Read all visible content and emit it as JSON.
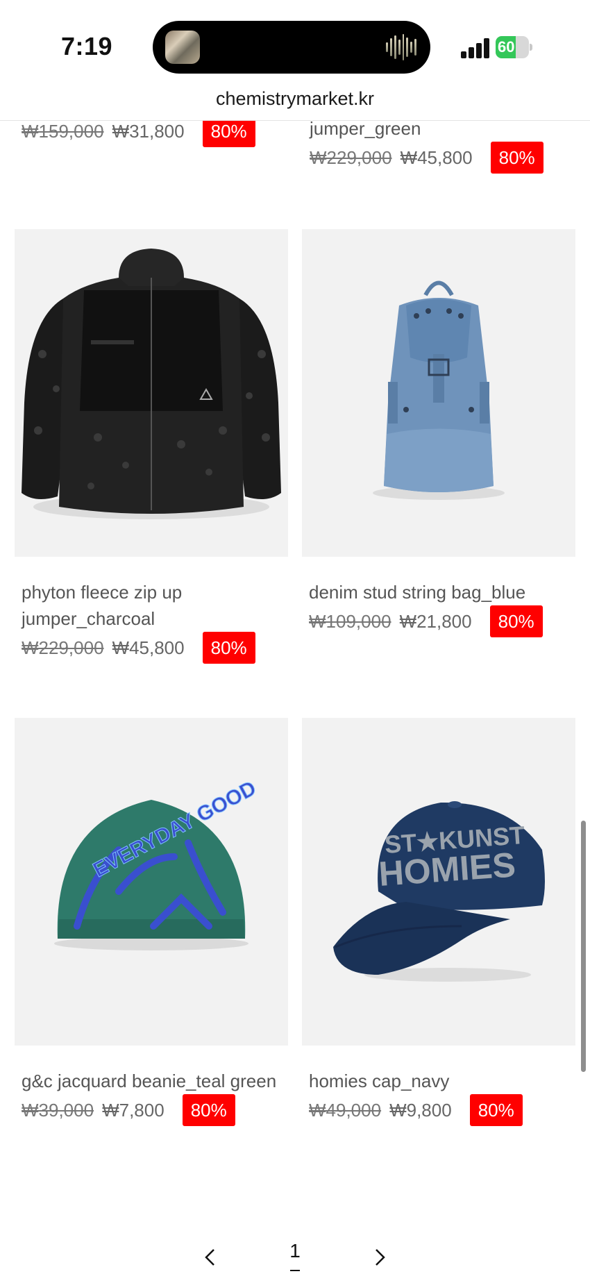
{
  "status_bar": {
    "time": "7:19",
    "battery_level": "60",
    "battery_fraction": 0.6,
    "signal_bars": 4
  },
  "browser": {
    "url": "chemistrymarket.kr"
  },
  "partial_products": [
    {
      "name": "",
      "original_price": "₩159,000",
      "sale_price": "₩31,800",
      "discount": "80%"
    },
    {
      "name": "jumper_green",
      "original_price": "₩229,000",
      "sale_price": "₩45,800",
      "discount": "80%"
    }
  ],
  "products": [
    {
      "name": "phyton fleece zip up jumper_charcoal",
      "original_price": "₩229,000",
      "sale_price": "₩45,800",
      "discount": "80%",
      "image_icon": "fleece-jacket"
    },
    {
      "name": "denim stud string bag_blue",
      "original_price": "₩109,000",
      "sale_price": "₩21,800",
      "discount": "80%",
      "image_icon": "denim-backpack"
    },
    {
      "name": "g&c jacquard beanie_teal green",
      "original_price": "₩39,000",
      "sale_price": "₩7,800",
      "discount": "80%",
      "image_icon": "beanie"
    },
    {
      "name": "homies cap_navy",
      "original_price": "₩49,000",
      "sale_price": "₩9,800",
      "discount": "80%",
      "image_icon": "baseball-cap"
    }
  ],
  "pagination": {
    "current_page": "1",
    "prev_icon": "chevron-left",
    "next_icon": "chevron-right"
  },
  "images": {
    "beanie_text": "EVERYDAY GOOD",
    "cap_text_top": "ST★KUNST",
    "cap_text_main": "HOMIES"
  },
  "colors": {
    "badge": "#ff0000",
    "image_bg": "#f2f2f2",
    "beanie": "#2e7a6a",
    "beanie_pattern": "#3a4fcf",
    "cap": "#1f3a63",
    "backpack": "#6f93bb",
    "jacket": "#1b1b1b"
  }
}
